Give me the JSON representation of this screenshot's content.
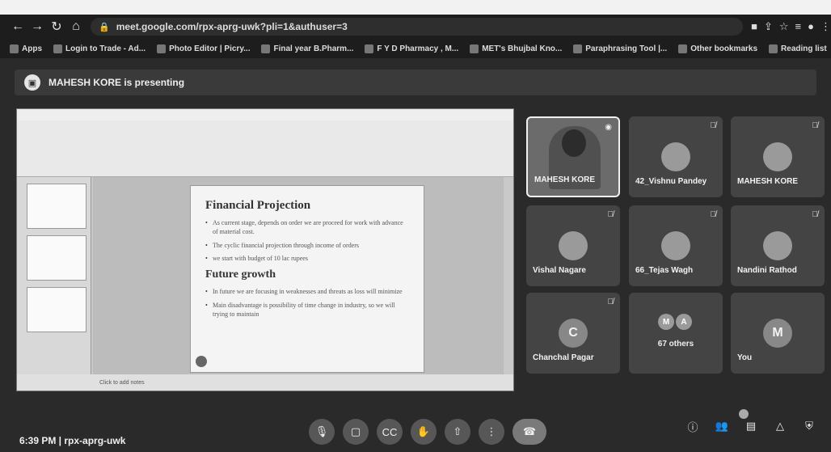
{
  "browser": {
    "url": "meet.google.com/rpx-aprg-uwk?pli=1&authuser=3",
    "bookmarks": [
      "Apps",
      "Login to Trade - Ad...",
      "Photo Editor | Picry...",
      "Final year B.Pharm...",
      "F Y D Pharmacy , M...",
      "MET's Bhujbal Kno...",
      "Paraphrasing Tool |..."
    ],
    "other_bookmarks": "Other bookmarks",
    "reading_list": "Reading list"
  },
  "presenting": {
    "text": "MAHESH KORE is presenting"
  },
  "slide": {
    "title": "Financial Projection",
    "bullets": [
      "As current stage, depends on order we are proceed for work with advance of material cost.",
      "The cyclic financial projection through income of orders",
      "we start with budget of 10 lac rupees"
    ],
    "subhead": "Future growth",
    "bullets2": [
      "In future we are focusing in weaknesses and threats as loss will minimize",
      "Main disadvantage is possibility of time change in industry, so we will trying to maintain"
    ],
    "notes_placeholder": "Click to add notes"
  },
  "participants": [
    {
      "name": "MAHESH KORE",
      "initial": "",
      "active": true
    },
    {
      "name": "42_Vishnu Pandey",
      "initial": ""
    },
    {
      "name": "MAHESH KORE",
      "initial": ""
    },
    {
      "name": "Vishal Nagare",
      "initial": ""
    },
    {
      "name": "66_Tejas Wagh",
      "initial": ""
    },
    {
      "name": "Nandini Rathod",
      "initial": ""
    },
    {
      "name": "Chanchal Pagar",
      "initial": "C"
    },
    {
      "name": "67 others",
      "initial": ""
    },
    {
      "name": "You",
      "initial": "M"
    }
  ],
  "others_initials": [
    "M",
    "A"
  ],
  "footer": {
    "time_code": "6:39 PM  |  rpx-aprg-uwk"
  },
  "icons": {
    "mute": "mic-off-icon"
  }
}
